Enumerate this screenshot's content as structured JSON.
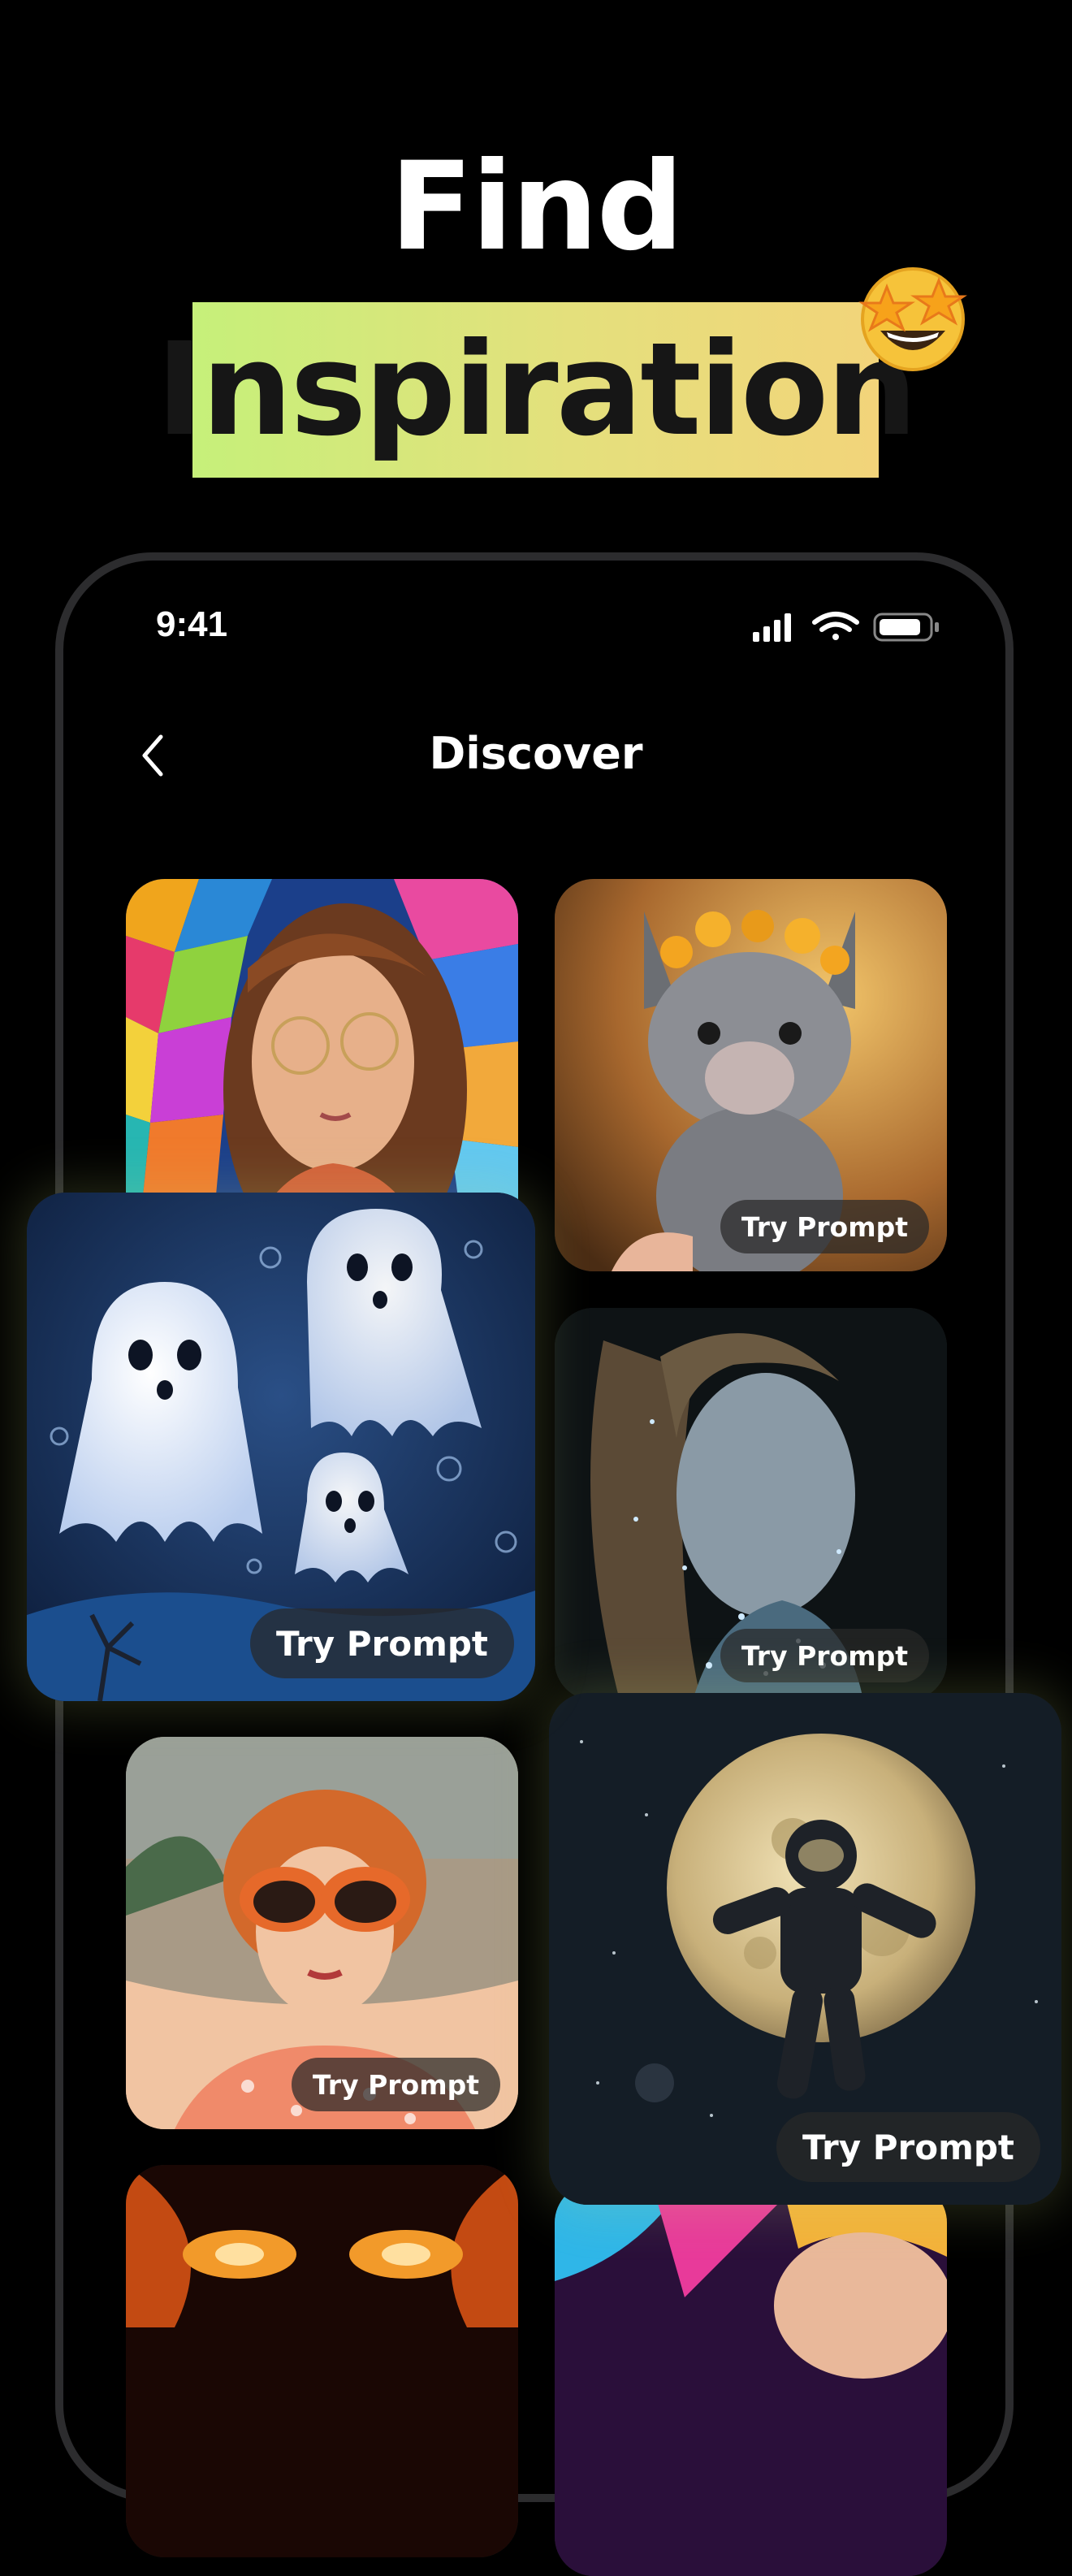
{
  "hero": {
    "line1": "Find",
    "line2": "Inspiration",
    "emoji": "star-struck-emoji",
    "highlight_colors": [
      "#c6f07a",
      "#f2d47a"
    ]
  },
  "status_bar": {
    "time": "9:41",
    "icons": [
      "cellular-signal-icon",
      "wifi-icon",
      "battery-icon"
    ]
  },
  "nav": {
    "title": "Discover",
    "back_icon": "chevron-left-icon"
  },
  "gallery": {
    "try_label": "Try Prompt",
    "items": [
      {
        "name": "stained-glass-girl-card",
        "try_label": null
      },
      {
        "name": "baby-llama-card",
        "try_label": "Try Prompt"
      },
      {
        "name": "ghosts-card",
        "try_label": "Try Prompt"
      },
      {
        "name": "sparkle-woman-card",
        "try_label": "Try Prompt"
      },
      {
        "name": "retro-sunglasses-card",
        "try_label": "Try Prompt"
      },
      {
        "name": "astronaut-moon-card",
        "try_label": "Try Prompt"
      },
      {
        "name": "fire-eyes-card",
        "try_label": null
      },
      {
        "name": "colorful-portrait-card",
        "try_label": null
      }
    ]
  }
}
